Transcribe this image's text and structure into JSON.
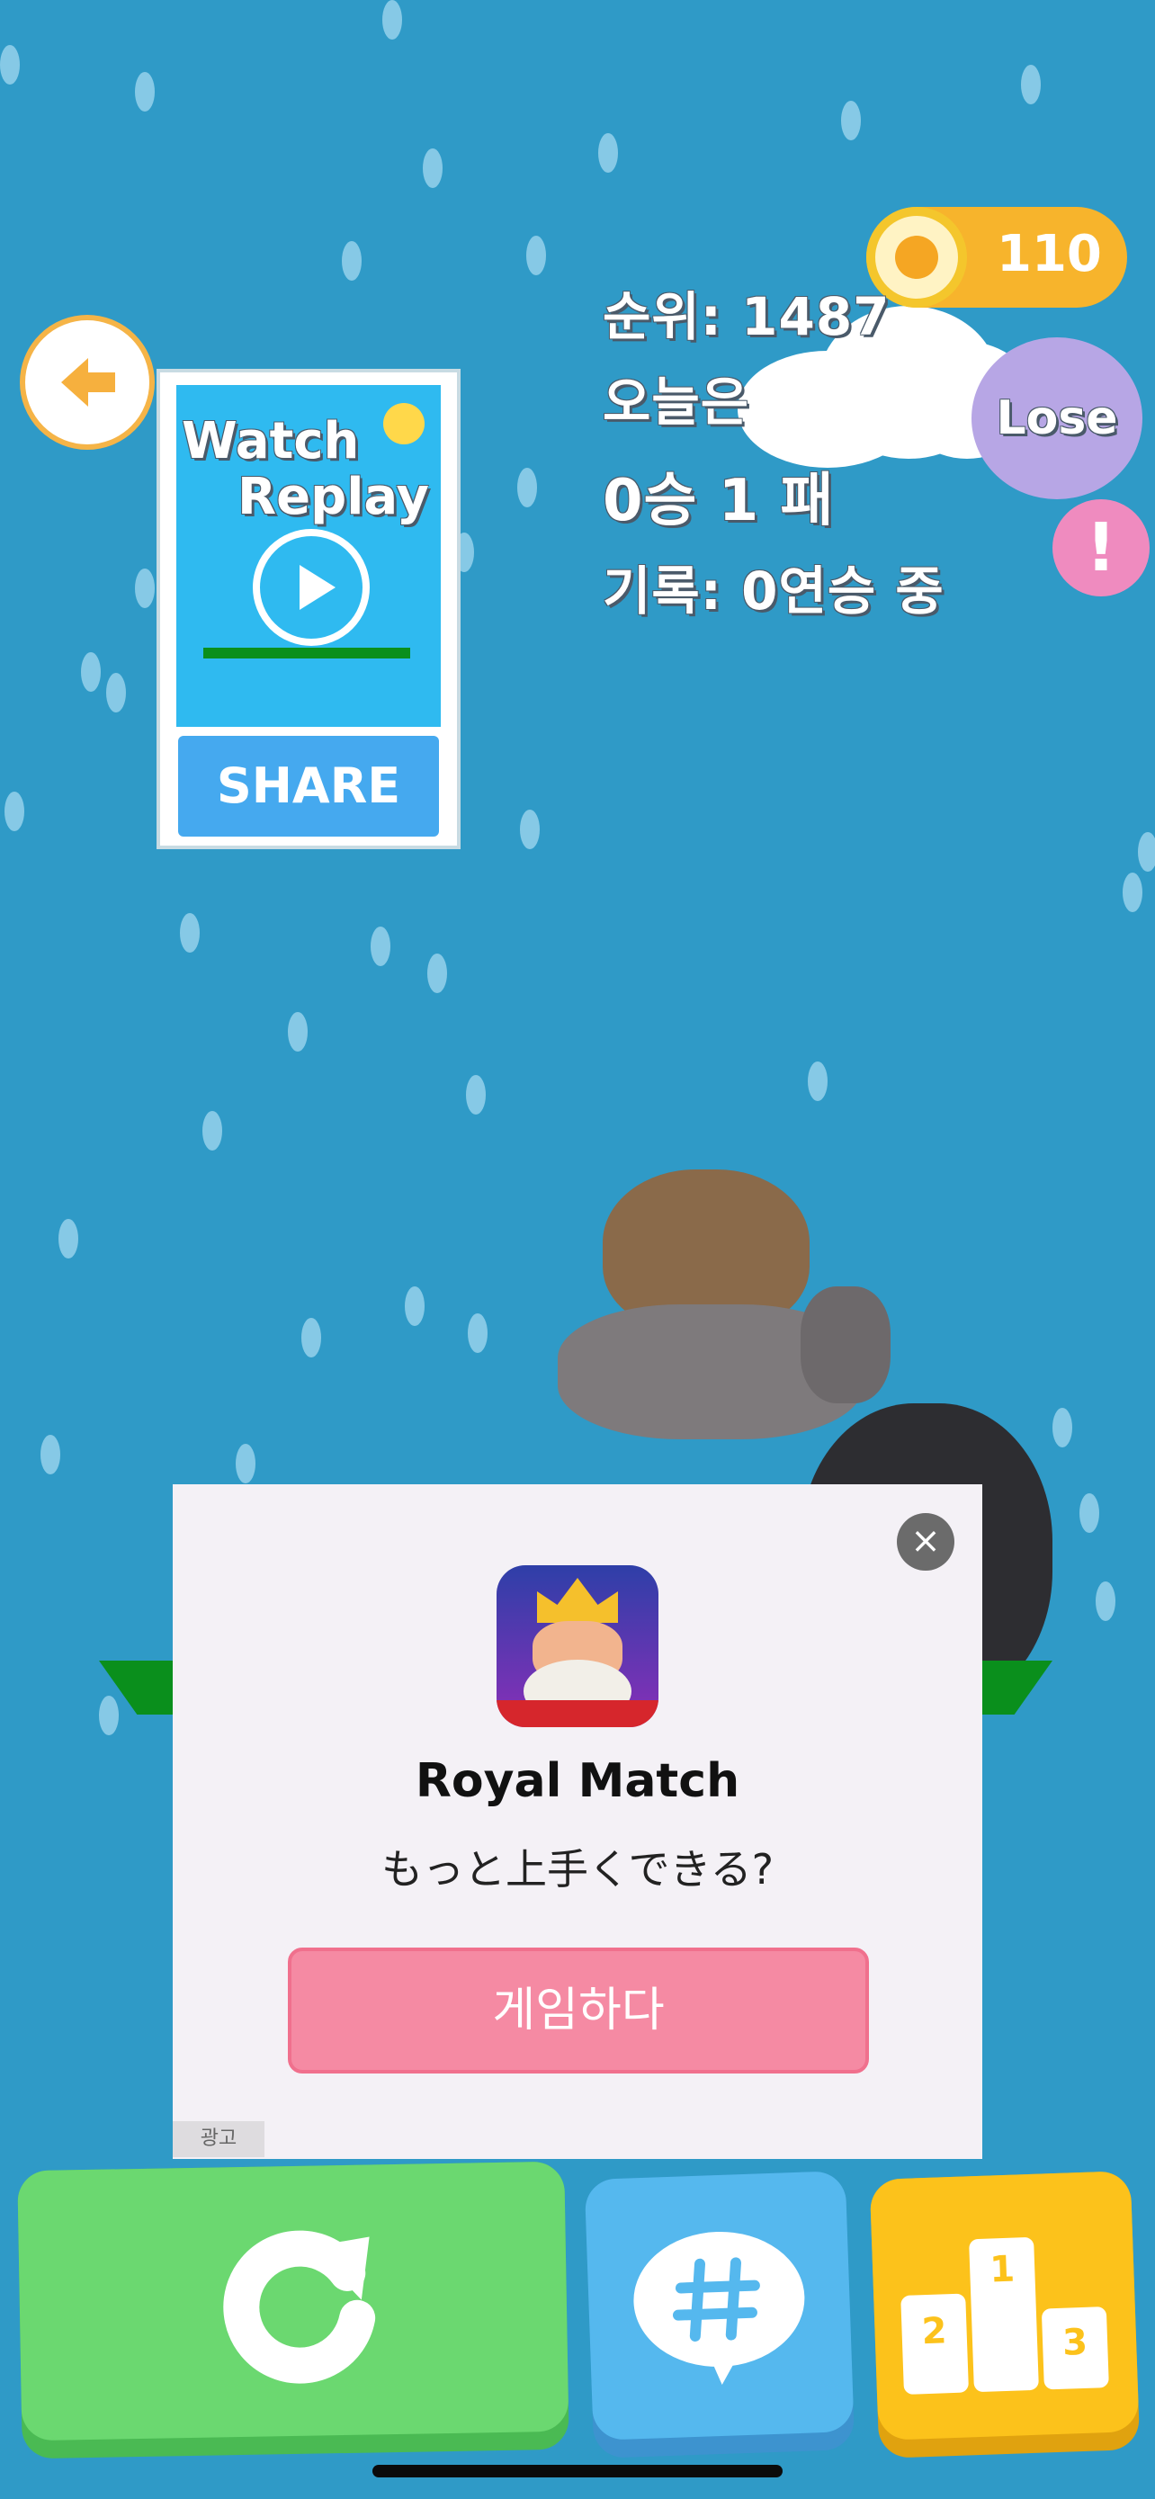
{
  "hud": {
    "coins": "110",
    "rank": "순위: 1487",
    "today_label": "오늘은",
    "today_record": "0승 1 패",
    "streak": "기록: 0연승 중",
    "result_badge": "Lose",
    "alert_symbol": "!"
  },
  "replay_card": {
    "title_line1": "Watch",
    "title_line2": "Replay",
    "share_label": "SHARE"
  },
  "ad": {
    "app_name": "Royal Match",
    "tagline": "もっと上手くできる?",
    "cta_label": "게임하다",
    "ad_tag": "광고",
    "close_symbol": "×"
  },
  "bottom_bar": {
    "restart": "restart-icon",
    "hashtag_chat": "hashtag-chat-icon",
    "leaderboard": "podium-icon",
    "podium_ranks": [
      "2",
      "1",
      "3"
    ]
  },
  "colors": {
    "sky": "#2f9ac7",
    "restart_button": "#6bd870",
    "chat_button": "#55b8ee",
    "leaderboard_button": "#fcc21b",
    "lose_badge": "#b7a6e5",
    "coin_pill": "#f7b42c"
  }
}
